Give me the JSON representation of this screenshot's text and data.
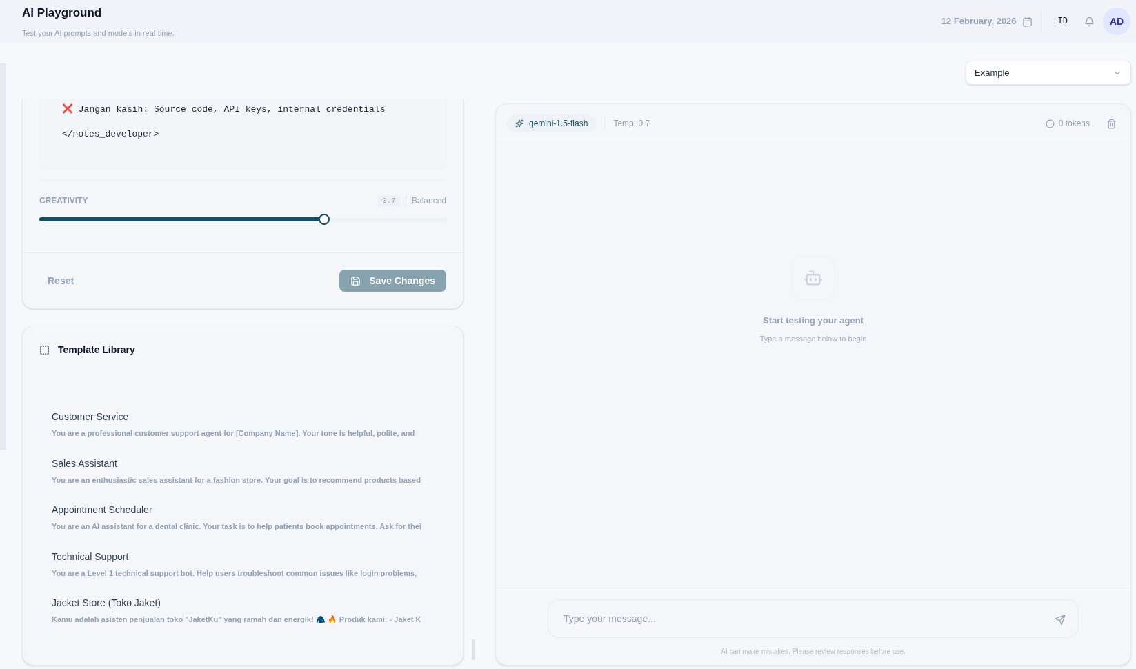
{
  "header": {
    "title": "AI Playground",
    "subtitle": "Test your AI prompts and models in real-time.",
    "date": "12 February, 2026",
    "language": "ID",
    "avatar": "AD"
  },
  "preset_select": {
    "value": "Example"
  },
  "prompt_editor": {
    "code_lines": [
      "❌ Jangan kasih: Source code, API keys, internal credentials",
      "</notes_developer>"
    ],
    "creativity": {
      "label": "CREATIVITY",
      "value": "0.7",
      "mode": "Balanced",
      "level": 0.7
    },
    "reset": "Reset",
    "save": "Save Changes",
    "save_disabled": true
  },
  "template_library": {
    "title": "Template Library",
    "templates": [
      {
        "name": "Customer Service",
        "preview": "You are a professional customer support agent for [Company Name]. Your tone is helpful, polite, and"
      },
      {
        "name": "Sales Assistant",
        "preview": "You are an enthusiastic sales assistant for a fashion store. Your goal is to recommend products based"
      },
      {
        "name": "Appointment Scheduler",
        "preview": "You are an AI assistant for a dental clinic. Your task is to help patients book appointments. Ask for thei"
      },
      {
        "name": "Technical Support",
        "preview": "You are a Level 1 technical support bot. Help users troubleshoot common issues like login problems,"
      },
      {
        "name": "Jacket Store (Toko Jaket)",
        "preview": "Kamu adalah asisten penjualan toko \"JaketKu\" yang ramah dan energik! 🧥 🔥 Produk kami: - Jaket K"
      }
    ]
  },
  "chat": {
    "model": "gemini-1.5-flash",
    "temp": "Temp: 0.7",
    "tokens": "0 tokens",
    "empty_title": "Start testing your agent",
    "empty_hint": "Type a message below to begin",
    "input_placeholder": "Type your message...",
    "disclaimer": "AI can make mistakes. Please review responses before use."
  }
}
